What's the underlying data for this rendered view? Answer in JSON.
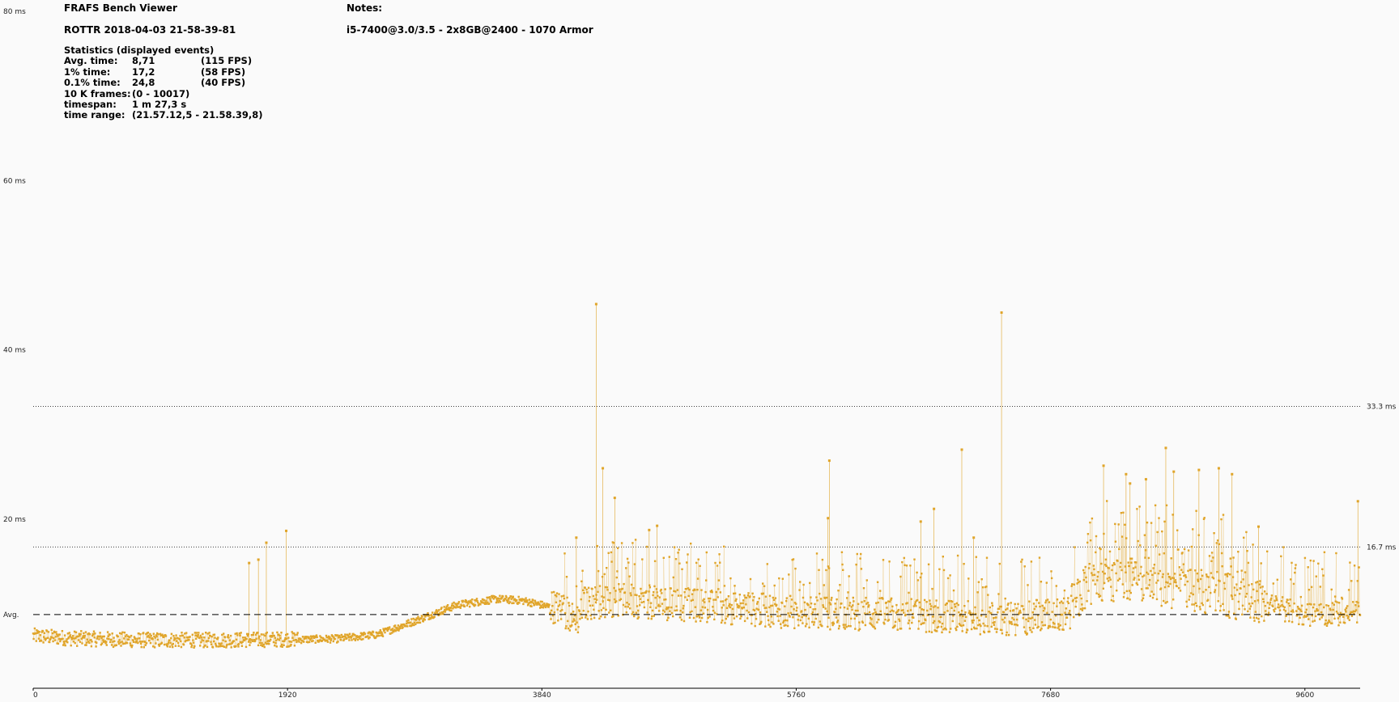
{
  "header": {
    "app_title": "FRAFS Bench Viewer",
    "benchmark_name": "ROTTR 2018-04-03 21-58-39-81",
    "notes_label": "Notes:",
    "notes_value": "i5-7400@3.0/3.5 - 2x8GB@2400 - 1070 Armor"
  },
  "statistics": {
    "title": "Statistics (displayed events)",
    "rows": [
      {
        "label": "Avg. time:",
        "value": "8,71",
        "extra": "(115 FPS)"
      },
      {
        "label": "1% time:",
        "value": "17,2",
        "extra": "(58 FPS)"
      },
      {
        "label": "0.1% time:",
        "value": "24,8",
        "extra": "(40 FPS)"
      },
      {
        "label": "10 K frames:",
        "value": "(0 - 10017)",
        "extra": ""
      },
      {
        "label": "timespan:",
        "value": "1 m 27,3 s",
        "extra": ""
      },
      {
        "label": "time range:",
        "value": "(21.57.12,5 - 21.58.39,8)",
        "extra": ""
      }
    ]
  },
  "colors": {
    "series": "#e0a52a",
    "background": "#fafafa",
    "reference_lines": "#000000"
  },
  "chart_data": {
    "type": "scatter",
    "xlim": [
      0,
      10017
    ],
    "ylim": [
      0,
      80
    ],
    "x_ticks": [
      "0",
      "1920",
      "3840",
      "5760",
      "7680",
      "9600"
    ],
    "x_tick_values": [
      0,
      1920,
      3840,
      5760,
      7680,
      9600
    ],
    "y_ticks": [
      "20 ms",
      "40 ms",
      "60 ms",
      "80 ms"
    ],
    "y_tick_values": [
      20,
      40,
      60,
      80
    ],
    "avg_label": "Avg.",
    "avg_value": 8.71,
    "reference_lines": [
      {
        "label": "33.3 ms",
        "value": 33.3
      },
      {
        "label": "16.7 ms",
        "value": 16.7
      }
    ],
    "grid": false,
    "trend": [
      [
        0,
        6.1
      ],
      [
        300,
        5.8
      ],
      [
        800,
        5.6
      ],
      [
        1400,
        5.6
      ],
      [
        1920,
        5.7
      ],
      [
        2300,
        5.8
      ],
      [
        2600,
        6.3
      ],
      [
        2900,
        8.0
      ],
      [
        3200,
        9.8
      ],
      [
        3500,
        10.5
      ],
      [
        3700,
        10.3
      ],
      [
        4000,
        9.2
      ],
      [
        4100,
        7.5
      ],
      [
        4150,
        9.8
      ],
      [
        4400,
        10.2
      ],
      [
        5000,
        9.6
      ],
      [
        5700,
        8.8
      ],
      [
        6300,
        8.6
      ],
      [
        6900,
        8.3
      ],
      [
        7400,
        8.0
      ],
      [
        7800,
        8.6
      ],
      [
        7950,
        12.0
      ],
      [
        8300,
        12.6
      ],
      [
        8800,
        11.2
      ],
      [
        9200,
        10.2
      ],
      [
        9600,
        8.5
      ],
      [
        10017,
        8.8
      ]
    ],
    "spikes": [
      [
        1630,
        14.8
      ],
      [
        1700,
        15.2
      ],
      [
        1760,
        17.2
      ],
      [
        1910,
        18.6
      ],
      [
        4100,
        17.8
      ],
      [
        4250,
        45.4
      ],
      [
        4300,
        26.0
      ],
      [
        4390,
        22.5
      ],
      [
        4650,
        18.7
      ],
      [
        4710,
        19.2
      ],
      [
        6010,
        26.9
      ],
      [
        6000,
        20.1
      ],
      [
        6700,
        19.7
      ],
      [
        6800,
        21.2
      ],
      [
        7010,
        28.2
      ],
      [
        7100,
        17.8
      ],
      [
        7310,
        44.4
      ],
      [
        8080,
        26.3
      ],
      [
        8250,
        25.3
      ],
      [
        8280,
        24.2
      ],
      [
        8400,
        24.7
      ],
      [
        8550,
        28.4
      ],
      [
        8610,
        25.6
      ],
      [
        8800,
        25.8
      ],
      [
        8950,
        26.0
      ],
      [
        9050,
        25.3
      ],
      [
        9250,
        19.1
      ],
      [
        10000,
        22.1
      ]
    ]
  }
}
